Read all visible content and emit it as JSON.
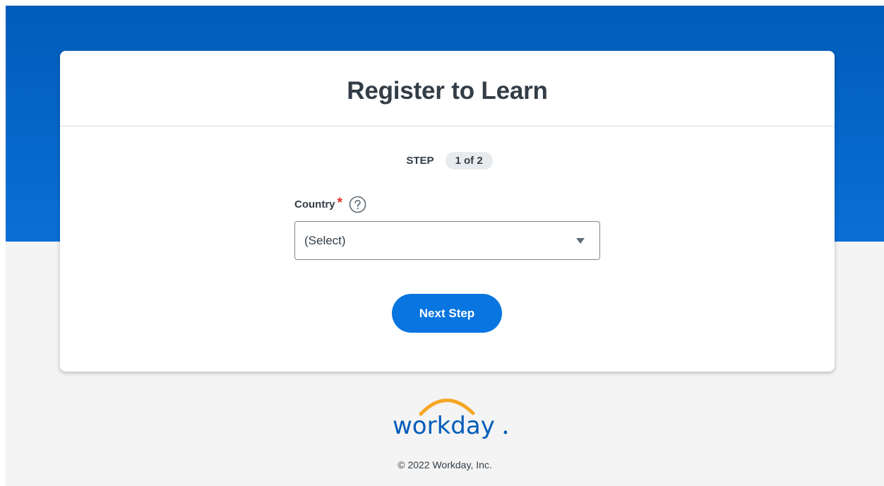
{
  "card": {
    "title": "Register to Learn"
  },
  "step": {
    "label": "STEP",
    "badge": "1 of 2"
  },
  "country_field": {
    "label": "Country",
    "required_mark": "*",
    "help_icon": "question-circle-icon",
    "selected_value": "(Select)",
    "dropdown_icon": "chevron-down-icon"
  },
  "actions": {
    "next_label": "Next Step"
  },
  "footer": {
    "logo_text": "workday",
    "copyright": "© 2022 Workday, Inc."
  },
  "colors": {
    "hero_top": "#005cb9",
    "hero_bottom": "#0a6fd6",
    "primary_button": "#0875e1",
    "required": "#de2e21",
    "logo_arc": "#f5a623",
    "logo_text": "#005cb9"
  }
}
